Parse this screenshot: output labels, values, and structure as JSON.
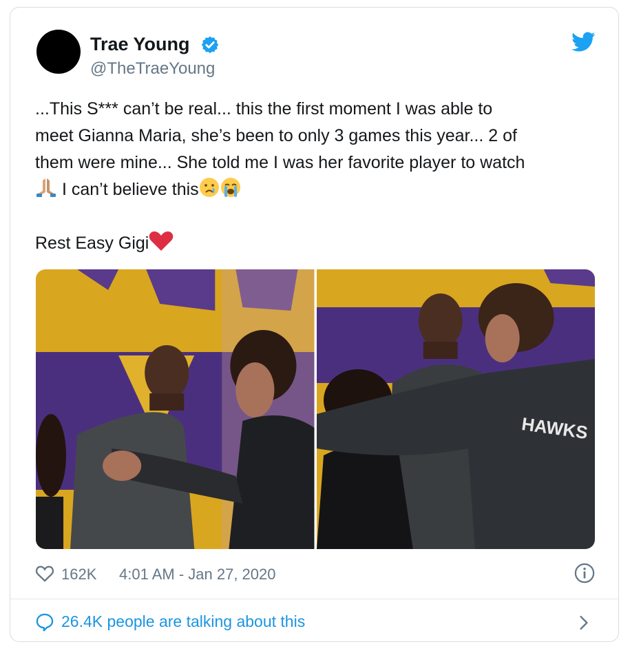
{
  "user": {
    "name": "Trae Young",
    "handle": "@TheTraeYoung"
  },
  "tweet": {
    "line1": "...This S*** can’t be real... this the first moment I was able to",
    "line2": "meet Gianna Maria, she’s been to only 3 games this year... 2 of",
    "line3": "them were mine... She told me I was her favorite player to watch",
    "line4": " I can’t believe this",
    "line5": "Rest Easy Gigi"
  },
  "stats": {
    "likes": "162K",
    "timestamp": "4:01 AM - Jan 27, 2020"
  },
  "conversation": {
    "label": "26.4K people are talking about this"
  },
  "colors": {
    "twitter_blue": "#1da1f2",
    "link_blue": "#1b95e0",
    "muted_gray": "#657786",
    "heart_red": "#e0245e"
  },
  "icons": [
    "verified-badge-icon",
    "twitter-bird-icon",
    "praying-hands-emoji",
    "crying-face-emoji",
    "loudly-crying-face-emoji",
    "red-heart-emoji",
    "heart-icon",
    "info-icon",
    "chat-bubble-icon",
    "chevron-right-icon"
  ]
}
